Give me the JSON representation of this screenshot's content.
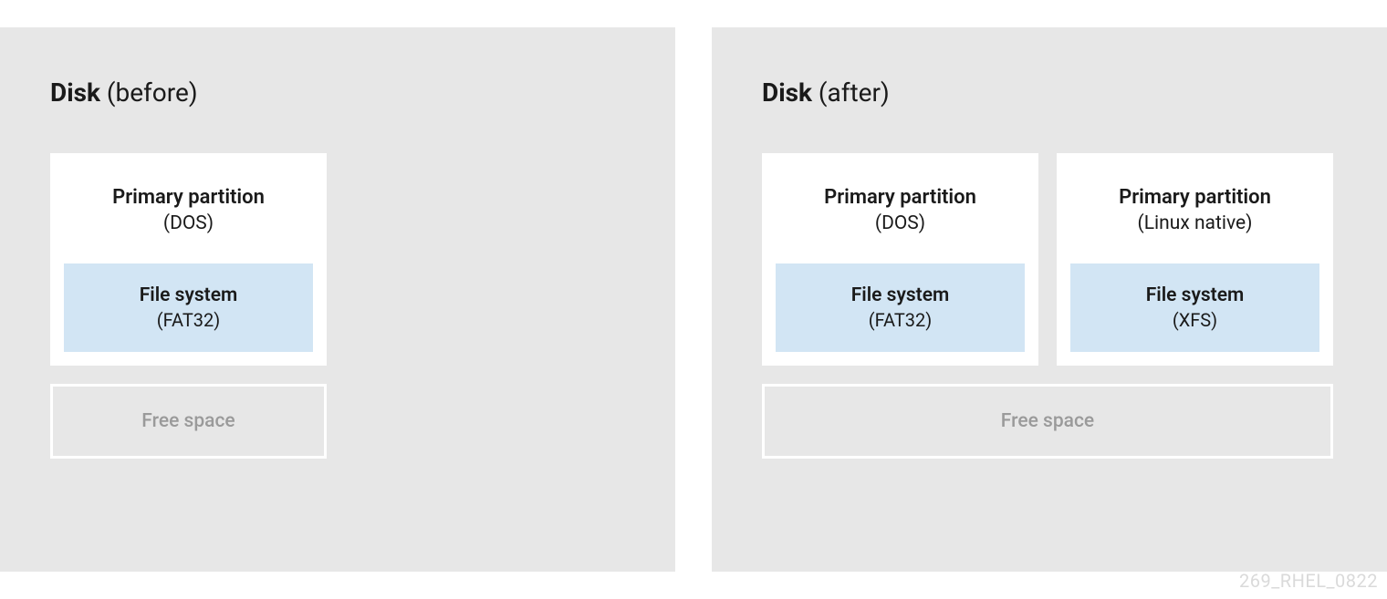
{
  "watermark": "269_RHEL_0822",
  "before": {
    "title_bold": "Disk",
    "title_qualifier": " (before)",
    "partitions": [
      {
        "title": "Primary partition",
        "subtitle": "(DOS)",
        "fs_title": "File system",
        "fs_subtitle": "(FAT32)"
      }
    ],
    "free_space": "Free space"
  },
  "after": {
    "title_bold": "Disk",
    "title_qualifier": " (after)",
    "partitions": [
      {
        "title": "Primary partition",
        "subtitle": "(DOS)",
        "fs_title": "File system",
        "fs_subtitle": "(FAT32)"
      },
      {
        "title": "Primary partition",
        "subtitle": "(Linux native)",
        "fs_title": "File system",
        "fs_subtitle": "(XFS)"
      }
    ],
    "free_space": "Free space"
  }
}
